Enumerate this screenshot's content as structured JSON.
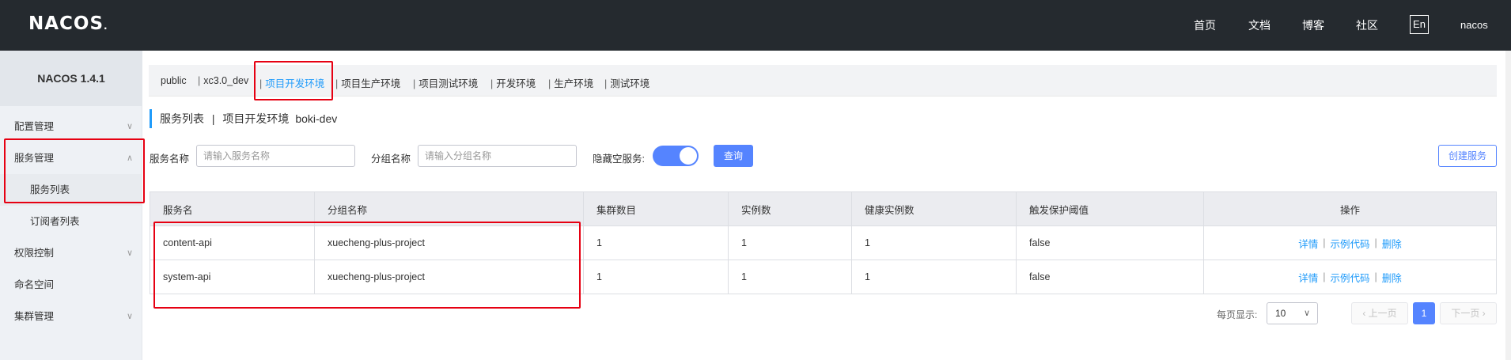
{
  "topbar": {
    "logo": "NACOS",
    "logo_dot": ".",
    "nav": [
      "首页",
      "文档",
      "博客",
      "社区"
    ],
    "lang": "En",
    "user": "nacos"
  },
  "sidebar": {
    "version": "NACOS 1.4.1",
    "items": [
      {
        "label": "配置管理",
        "chevron": "chevron-down-icon"
      },
      {
        "label": "服务管理",
        "chevron": "chevron-up-icon"
      },
      {
        "label": "服务列表"
      },
      {
        "label": "订阅者列表"
      },
      {
        "label": "权限控制",
        "chevron": "chevron-down-icon"
      },
      {
        "label": "命名空间"
      },
      {
        "label": "集群管理",
        "chevron": "chevron-down-icon"
      }
    ]
  },
  "namespaces": [
    "public",
    "xc3.0_dev",
    "项目开发环境",
    "项目生产环境",
    "项目测试环境",
    "开发环境",
    "生产环境",
    "测试环境"
  ],
  "namespace_separator": "|",
  "active_namespace_index": 2,
  "page": {
    "title": "服务列表",
    "title_sep": "|",
    "namespace": "项目开发环境",
    "namespace_id": "boki-dev"
  },
  "filters": {
    "service_name_label": "服务名称",
    "service_name_placeholder": "请输入服务名称",
    "group_name_label": "分组名称",
    "group_name_placeholder": "请输入分组名称",
    "hide_empty_label": "隐藏空服务:",
    "hide_empty_on": true,
    "query_button": "查询",
    "create_button": "创建服务"
  },
  "table": {
    "headers": [
      "服务名",
      "分组名称",
      "集群数目",
      "实例数",
      "健康实例数",
      "触发保护阈值",
      "操作"
    ],
    "rows": [
      [
        "content-api",
        "xuecheng-plus-project",
        "1",
        "1",
        "1",
        "false"
      ],
      [
        "system-api",
        "xuecheng-plus-project",
        "1",
        "1",
        "1",
        "false"
      ]
    ],
    "actions": [
      "详情",
      "示例代码",
      "删除"
    ],
    "action_sep": "|"
  },
  "pagination": {
    "page_size_label": "每页显示:",
    "page_size": "10",
    "prev": "上一页",
    "prev_icon": "‹",
    "next": "下一页",
    "next_icon": "›",
    "current_page": "1"
  },
  "colors": {
    "topbar": "#252a2f",
    "accent": "#209bfa",
    "primary_button": "#5584ff",
    "annotation": "#e60012"
  }
}
